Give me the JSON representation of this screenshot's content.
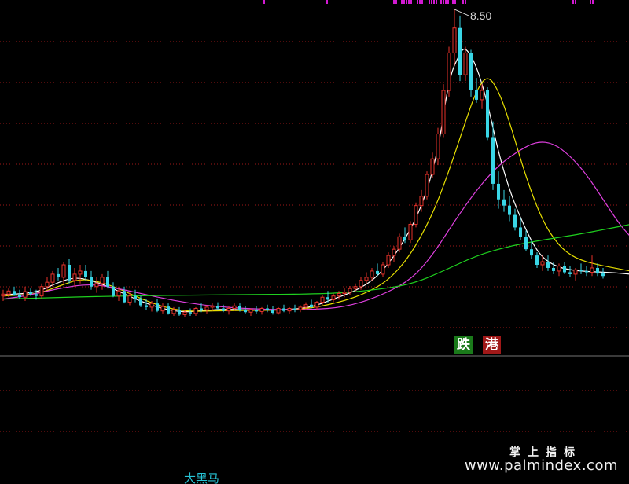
{
  "chart_data": {
    "type": "candlestick",
    "annotation_high": "8.50",
    "ylim": [
      3.0,
      8.6
    ],
    "colors": {
      "up": "#e8322a",
      "down": "#39d6e6",
      "ma5": "#ffffff",
      "ma10": "#e8e000",
      "ma20": "#e040e0",
      "ma60": "#1fd11f",
      "grid": "#a01818",
      "separator": "#3a3a3a"
    },
    "candles": [
      [
        3.9,
        4.0,
        3.82,
        3.93
      ],
      [
        3.93,
        4.02,
        3.88,
        3.98
      ],
      [
        3.98,
        4.05,
        3.9,
        3.92
      ],
      [
        3.92,
        4.0,
        3.85,
        3.88
      ],
      [
        3.88,
        4.05,
        3.82,
        3.97
      ],
      [
        3.97,
        4.02,
        3.9,
        3.93
      ],
      [
        3.93,
        4.0,
        3.84,
        3.9
      ],
      [
        3.9,
        4.1,
        3.86,
        4.05
      ],
      [
        4.05,
        4.2,
        4.0,
        4.12
      ],
      [
        4.12,
        4.3,
        4.05,
        4.25
      ],
      [
        4.25,
        4.35,
        4.15,
        4.2
      ],
      [
        4.2,
        4.45,
        4.1,
        4.4
      ],
      [
        4.4,
        4.5,
        4.1,
        4.15
      ],
      [
        4.15,
        4.35,
        4.05,
        4.25
      ],
      [
        4.25,
        4.4,
        4.1,
        4.3
      ],
      [
        4.3,
        4.4,
        4.15,
        4.2
      ],
      [
        4.2,
        4.3,
        4.0,
        4.05
      ],
      [
        4.05,
        4.2,
        3.95,
        4.1
      ],
      [
        4.1,
        4.25,
        4.0,
        4.2
      ],
      [
        4.2,
        4.3,
        4.02,
        4.05
      ],
      [
        4.05,
        4.12,
        3.88,
        3.9
      ],
      [
        3.9,
        4.05,
        3.82,
        3.98
      ],
      [
        3.98,
        4.05,
        3.78,
        3.8
      ],
      [
        3.8,
        3.95,
        3.75,
        3.9
      ],
      [
        3.9,
        4.0,
        3.8,
        3.85
      ],
      [
        3.85,
        3.9,
        3.72,
        3.75
      ],
      [
        3.75,
        3.85,
        3.68,
        3.72
      ],
      [
        3.72,
        3.82,
        3.65,
        3.78
      ],
      [
        3.78,
        3.85,
        3.64,
        3.66
      ],
      [
        3.66,
        3.78,
        3.62,
        3.73
      ],
      [
        3.73,
        3.78,
        3.6,
        3.62
      ],
      [
        3.62,
        3.72,
        3.58,
        3.68
      ],
      [
        3.68,
        3.72,
        3.58,
        3.6
      ],
      [
        3.6,
        3.68,
        3.56,
        3.64
      ],
      [
        3.64,
        3.7,
        3.58,
        3.62
      ],
      [
        3.62,
        3.72,
        3.58,
        3.7
      ],
      [
        3.7,
        3.78,
        3.64,
        3.68
      ],
      [
        3.68,
        3.75,
        3.62,
        3.72
      ],
      [
        3.72,
        3.78,
        3.66,
        3.74
      ],
      [
        3.74,
        3.8,
        3.68,
        3.7
      ],
      [
        3.7,
        3.76,
        3.64,
        3.66
      ],
      [
        3.66,
        3.74,
        3.6,
        3.7
      ],
      [
        3.7,
        3.78,
        3.66,
        3.74
      ],
      [
        3.74,
        3.78,
        3.65,
        3.68
      ],
      [
        3.68,
        3.74,
        3.62,
        3.64
      ],
      [
        3.64,
        3.7,
        3.58,
        3.68
      ],
      [
        3.68,
        3.74,
        3.62,
        3.65
      ],
      [
        3.65,
        3.72,
        3.6,
        3.7
      ],
      [
        3.7,
        3.76,
        3.64,
        3.68
      ],
      [
        3.68,
        3.74,
        3.6,
        3.63
      ],
      [
        3.63,
        3.72,
        3.6,
        3.7
      ],
      [
        3.7,
        3.76,
        3.64,
        3.66
      ],
      [
        3.66,
        3.72,
        3.62,
        3.7
      ],
      [
        3.7,
        3.76,
        3.64,
        3.68
      ],
      [
        3.68,
        3.75,
        3.64,
        3.72
      ],
      [
        3.72,
        3.8,
        3.68,
        3.76
      ],
      [
        3.76,
        3.84,
        3.7,
        3.72
      ],
      [
        3.72,
        3.82,
        3.68,
        3.8
      ],
      [
        3.8,
        3.92,
        3.76,
        3.88
      ],
      [
        3.88,
        3.98,
        3.8,
        3.84
      ],
      [
        3.84,
        3.94,
        3.8,
        3.9
      ],
      [
        3.9,
        3.98,
        3.84,
        3.94
      ],
      [
        3.94,
        4.02,
        3.88,
        3.96
      ],
      [
        3.96,
        4.06,
        3.92,
        4.02
      ],
      [
        4.02,
        4.1,
        3.96,
        4.05
      ],
      [
        4.05,
        4.2,
        4.0,
        4.15
      ],
      [
        4.15,
        4.28,
        4.1,
        4.2
      ],
      [
        4.2,
        4.35,
        4.15,
        4.3
      ],
      [
        4.3,
        4.42,
        4.22,
        4.25
      ],
      [
        4.25,
        4.45,
        4.2,
        4.4
      ],
      [
        4.4,
        4.6,
        4.35,
        4.55
      ],
      [
        4.55,
        4.7,
        4.45,
        4.65
      ],
      [
        4.65,
        4.9,
        4.6,
        4.85
      ],
      [
        4.85,
        5.0,
        4.75,
        4.8
      ],
      [
        4.8,
        5.1,
        4.75,
        5.05
      ],
      [
        5.05,
        5.4,
        5.0,
        5.35
      ],
      [
        5.35,
        5.6,
        5.25,
        5.5
      ],
      [
        5.5,
        5.9,
        5.45,
        5.85
      ],
      [
        5.85,
        6.2,
        5.8,
        6.1
      ],
      [
        6.1,
        6.6,
        6.0,
        6.5
      ],
      [
        6.5,
        7.3,
        6.45,
        7.2
      ],
      [
        7.2,
        7.9,
        7.1,
        7.8
      ],
      [
        7.8,
        8.5,
        7.6,
        8.2
      ],
      [
        8.2,
        8.4,
        7.35,
        7.45
      ],
      [
        7.45,
        7.9,
        7.35,
        7.8
      ],
      [
        7.8,
        7.85,
        7.1,
        7.2
      ],
      [
        7.2,
        7.4,
        7.0,
        7.05
      ],
      [
        7.05,
        7.3,
        6.9,
        7.2
      ],
      [
        7.2,
        7.25,
        6.4,
        6.45
      ],
      [
        6.45,
        6.7,
        5.6,
        5.7
      ],
      [
        5.7,
        5.9,
        5.3,
        5.45
      ],
      [
        5.45,
        5.6,
        5.25,
        5.35
      ],
      [
        5.35,
        5.5,
        5.1,
        5.2
      ],
      [
        5.2,
        5.3,
        4.95,
        5.0
      ],
      [
        5.0,
        5.15,
        4.8,
        4.85
      ],
      [
        4.85,
        4.95,
        4.62,
        4.65
      ],
      [
        4.65,
        4.8,
        4.5,
        4.55
      ],
      [
        4.55,
        4.6,
        4.35,
        4.4
      ],
      [
        4.4,
        4.55,
        4.3,
        4.45
      ],
      [
        4.45,
        4.55,
        4.3,
        4.35
      ],
      [
        4.35,
        4.45,
        4.25,
        4.3
      ],
      [
        4.3,
        4.42,
        4.22,
        4.38
      ],
      [
        4.38,
        4.45,
        4.25,
        4.28
      ],
      [
        4.28,
        4.38,
        4.2,
        4.25
      ],
      [
        4.25,
        4.35,
        4.15,
        4.32
      ],
      [
        4.32,
        4.42,
        4.25,
        4.3
      ],
      [
        4.3,
        4.38,
        4.22,
        4.28
      ],
      [
        4.28,
        4.55,
        4.22,
        4.35
      ],
      [
        4.35,
        4.42,
        4.22,
        4.26
      ],
      [
        4.26,
        4.35,
        4.18,
        4.22
      ]
    ],
    "ma_series": [
      {
        "key": "ma5",
        "points": [
          [
            0,
            3.92
          ],
          [
            6,
            3.95
          ],
          [
            10,
            4.12
          ],
          [
            13,
            4.2
          ],
          [
            16,
            4.15
          ],
          [
            20,
            4.02
          ],
          [
            24,
            3.85
          ],
          [
            28,
            3.72
          ],
          [
            32,
            3.64
          ],
          [
            36,
            3.66
          ],
          [
            40,
            3.69
          ],
          [
            46,
            3.67
          ],
          [
            52,
            3.68
          ],
          [
            56,
            3.72
          ],
          [
            60,
            3.85
          ],
          [
            64,
            3.98
          ],
          [
            68,
            4.2
          ],
          [
            72,
            4.65
          ],
          [
            76,
            5.3
          ],
          [
            79,
            6.2
          ],
          [
            81,
            7.4
          ],
          [
            83,
            7.8
          ],
          [
            84,
            7.9
          ],
          [
            86,
            7.6
          ],
          [
            88,
            7.0
          ],
          [
            90,
            6.2
          ],
          [
            92,
            5.6
          ],
          [
            94,
            5.15
          ],
          [
            97,
            4.6
          ],
          [
            100,
            4.38
          ],
          [
            104,
            4.3
          ],
          [
            110,
            4.28
          ],
          [
            114,
            4.25
          ]
        ]
      },
      {
        "key": "ma10",
        "points": [
          [
            0,
            3.9
          ],
          [
            6,
            3.93
          ],
          [
            10,
            4.05
          ],
          [
            14,
            4.18
          ],
          [
            18,
            4.12
          ],
          [
            22,
            3.98
          ],
          [
            26,
            3.82
          ],
          [
            30,
            3.7
          ],
          [
            34,
            3.65
          ],
          [
            38,
            3.66
          ],
          [
            44,
            3.67
          ],
          [
            50,
            3.67
          ],
          [
            56,
            3.7
          ],
          [
            62,
            3.82
          ],
          [
            66,
            3.95
          ],
          [
            70,
            4.15
          ],
          [
            74,
            4.55
          ],
          [
            78,
            5.2
          ],
          [
            81,
            5.9
          ],
          [
            84,
            6.7
          ],
          [
            86,
            7.2
          ],
          [
            88,
            7.45
          ],
          [
            90,
            7.2
          ],
          [
            92,
            6.7
          ],
          [
            95,
            5.8
          ],
          [
            98,
            5.1
          ],
          [
            101,
            4.7
          ],
          [
            104,
            4.5
          ],
          [
            108,
            4.4
          ],
          [
            114,
            4.3
          ]
        ]
      },
      {
        "key": "ma20",
        "points": [
          [
            0,
            3.85
          ],
          [
            4,
            3.9
          ],
          [
            10,
            4.02
          ],
          [
            16,
            4.1
          ],
          [
            22,
            4.0
          ],
          [
            28,
            3.88
          ],
          [
            34,
            3.78
          ],
          [
            40,
            3.72
          ],
          [
            48,
            3.68
          ],
          [
            56,
            3.68
          ],
          [
            62,
            3.72
          ],
          [
            68,
            3.88
          ],
          [
            74,
            4.15
          ],
          [
            78,
            4.55
          ],
          [
            82,
            5.1
          ],
          [
            86,
            5.6
          ],
          [
            90,
            6.0
          ],
          [
            94,
            6.25
          ],
          [
            97,
            6.38
          ],
          [
            100,
            6.35
          ],
          [
            103,
            6.15
          ],
          [
            106,
            5.85
          ],
          [
            109,
            5.45
          ],
          [
            112,
            5.05
          ],
          [
            114,
            4.85
          ]
        ]
      },
      {
        "key": "ma60",
        "points": [
          [
            0,
            3.85
          ],
          [
            20,
            3.9
          ],
          [
            40,
            3.92
          ],
          [
            58,
            3.93
          ],
          [
            66,
            3.98
          ],
          [
            74,
            4.08
          ],
          [
            80,
            4.3
          ],
          [
            86,
            4.55
          ],
          [
            92,
            4.7
          ],
          [
            98,
            4.8
          ],
          [
            104,
            4.88
          ],
          [
            110,
            4.98
          ],
          [
            114,
            5.05
          ]
        ]
      }
    ]
  },
  "tags": {
    "die": "跌",
    "gang": "港"
  },
  "watermark": {
    "cn": "掌上指标",
    "url": "www.palmindex.com"
  },
  "bottom_label": "大黑马"
}
